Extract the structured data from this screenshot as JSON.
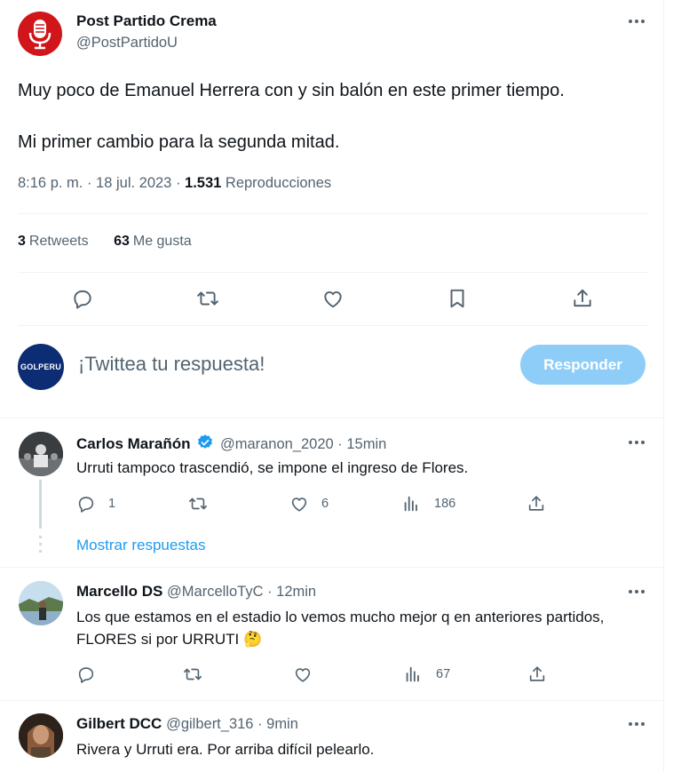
{
  "tweet": {
    "author_name": "Post Partido Crema",
    "author_handle": "@PostPartidoU",
    "text_line1": "Muy poco de Emanuel Herrera con y sin balón en este primer tiempo.",
    "text_line2": "Mi primer cambio para la segunda mitad.",
    "time": "8:16 p. m. · 18 jul. 2023 · ",
    "views_count": "1.531",
    "views_label": " Reproducciones",
    "retweets_count": "3",
    "retweets_label": "Retweets",
    "likes_count": "63",
    "likes_label": "Me gusta"
  },
  "composer": {
    "avatar_text": "GOLPERU",
    "placeholder": "¡Twittea tu respuesta!",
    "reply_button": "Responder"
  },
  "replies": [
    {
      "name": "Carlos Marañón",
      "handle": "@maranon_2020 · 15min",
      "verified": true,
      "text": "Urruti tampoco trascendió, se impone el ingreso de Flores.",
      "reply_count": "1",
      "retweet_count": "",
      "like_count": "6",
      "view_count": "186",
      "show_replies": "Mostrar respuestas"
    },
    {
      "name": "Marcello DS",
      "handle": "@MarcelloTyC · 12min",
      "verified": false,
      "text": "Los que estamos en el estadio lo vemos mucho mejor q en anteriores partidos, FLORES si por URRUTI 🤔",
      "reply_count": "",
      "retweet_count": "",
      "like_count": "",
      "view_count": "67"
    },
    {
      "name": "Gilbert DCC",
      "handle": "@gilbert_316 · 9min",
      "verified": false,
      "text": "Rivera y Urruti era. Por arriba difícil pelearlo."
    }
  ],
  "colors": {
    "accent": "#1d9bf0",
    "reply_button_disabled": "#8ecdf8",
    "muted": "#536471",
    "brand_red": "#d0151b",
    "golperu_blue": "#0c2c74"
  },
  "icons": [
    "microphone-icon",
    "more-icon",
    "reply-icon",
    "retweet-icon",
    "like-icon",
    "bookmark-icon",
    "share-icon",
    "views-icon",
    "verified-icon"
  ]
}
